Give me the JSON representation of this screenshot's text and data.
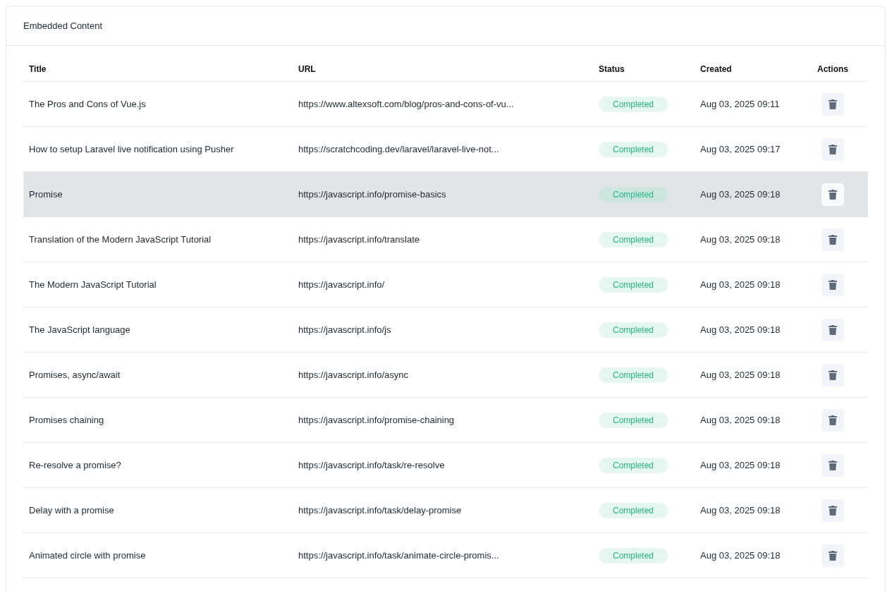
{
  "card": {
    "title": "Embedded Content"
  },
  "table": {
    "columns": [
      "Title",
      "URL",
      "Status",
      "Created",
      "Actions"
    ],
    "rows": [
      {
        "title": "The Pros and Cons of Vue.js",
        "url": "https://www.altexsoft.com/blog/pros-and-cons-of-vu...",
        "status": "Completed",
        "created": "Aug 03, 2025 09:11",
        "highlighted": false
      },
      {
        "title": "How to setup Laravel live notification using Pusher",
        "url": "https://scratchcoding.dev/laravel/laravel-live-not...",
        "status": "Completed",
        "created": "Aug 03, 2025 09:17",
        "highlighted": false
      },
      {
        "title": "Promise",
        "url": "https://javascript.info/promise-basics",
        "status": "Completed",
        "created": "Aug 03, 2025 09:18",
        "highlighted": true
      },
      {
        "title": "Translation of the Modern JavaScript Tutorial",
        "url": "https://javascript.info/translate",
        "status": "Completed",
        "created": "Aug 03, 2025 09:18",
        "highlighted": false
      },
      {
        "title": "The Modern JavaScript Tutorial",
        "url": "https://javascript.info/",
        "status": "Completed",
        "created": "Aug 03, 2025 09:18",
        "highlighted": false
      },
      {
        "title": "The JavaScript language",
        "url": "https://javascript.info/js",
        "status": "Completed",
        "created": "Aug 03, 2025 09:18",
        "highlighted": false
      },
      {
        "title": "Promises, async/await",
        "url": "https://javascript.info/async",
        "status": "Completed",
        "created": "Aug 03, 2025 09:18",
        "highlighted": false
      },
      {
        "title": "Promises chaining",
        "url": "https://javascript.info/promise-chaining",
        "status": "Completed",
        "created": "Aug 03, 2025 09:18",
        "highlighted": false
      },
      {
        "title": "Re-resolve a promise?",
        "url": "https://javascript.info/task/re-resolve",
        "status": "Completed",
        "created": "Aug 03, 2025 09:18",
        "highlighted": false
      },
      {
        "title": "Delay with a promise",
        "url": "https://javascript.info/task/delay-promise",
        "status": "Completed",
        "created": "Aug 03, 2025 09:18",
        "highlighted": false
      },
      {
        "title": "Animated circle with promise",
        "url": "https://javascript.info/task/animate-circle-promis...",
        "status": "Completed",
        "created": "Aug 03, 2025 09:18",
        "highlighted": false
      }
    ]
  }
}
